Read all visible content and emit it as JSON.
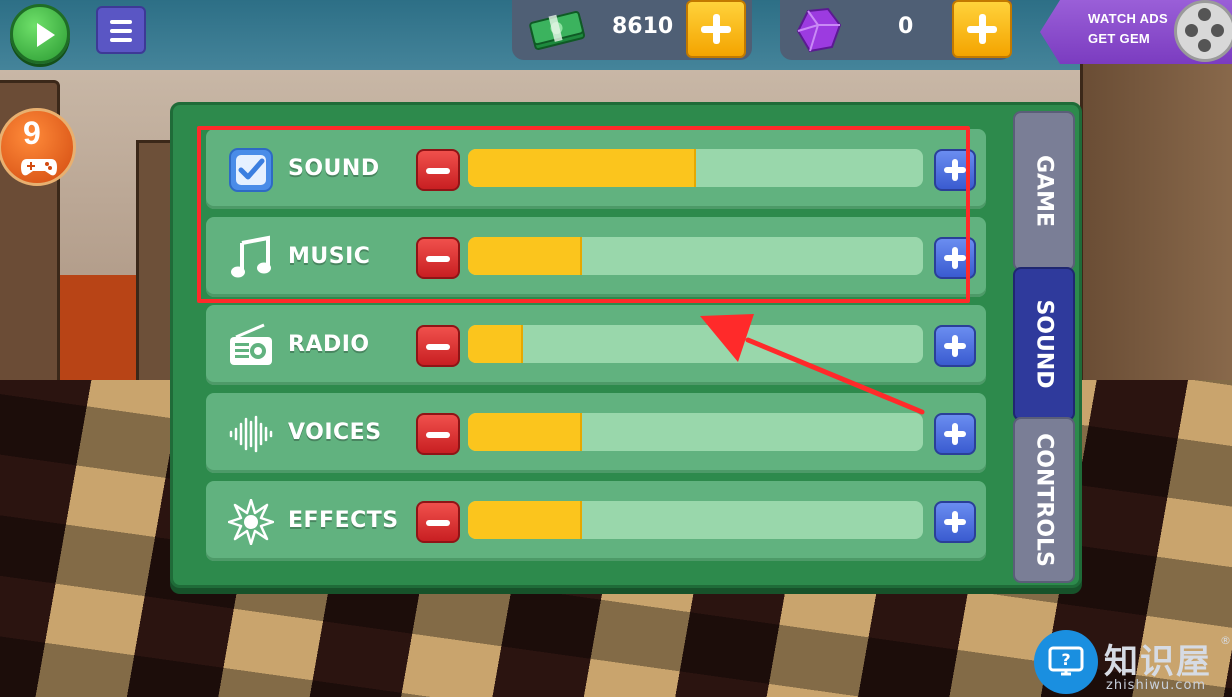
{
  "top_bar": {
    "cash_value": "8610",
    "gem_value": "0",
    "watch_ads_line1": "WATCH ADS",
    "watch_ads_line2": "GET GEM"
  },
  "level_badge": {
    "number": "9"
  },
  "settings": {
    "rows": [
      {
        "label": "SOUND",
        "icon": "checkbox-checked-icon",
        "level": 0.5
      },
      {
        "label": "MUSIC",
        "icon": "music-note-icon",
        "level": 0.25
      },
      {
        "label": "RADIO",
        "icon": "radio-icon",
        "level": 0.12
      },
      {
        "label": "VOICES",
        "icon": "soundwave-icon",
        "level": 0.25
      },
      {
        "label": "EFFECTS",
        "icon": "burst-icon",
        "level": 0.25
      }
    ],
    "tabs": [
      {
        "label": "GAME",
        "active": false
      },
      {
        "label": "SOUND",
        "active": true
      },
      {
        "label": "CONTROLS",
        "active": false
      }
    ]
  },
  "watermark": {
    "brand": "知识屋",
    "registered": "®",
    "domain": "zhishiwu.com"
  },
  "colors": {
    "panel": "#2d8a4c",
    "row": "#61b27f",
    "track": "#99d7ab",
    "fill": "#fbc51d",
    "minus": "#d8302f",
    "plus": "#4a6ee0",
    "tab_active": "#2f3a9c",
    "tab_inactive": "#7a7e96",
    "highlight": "#ff2a2a"
  }
}
